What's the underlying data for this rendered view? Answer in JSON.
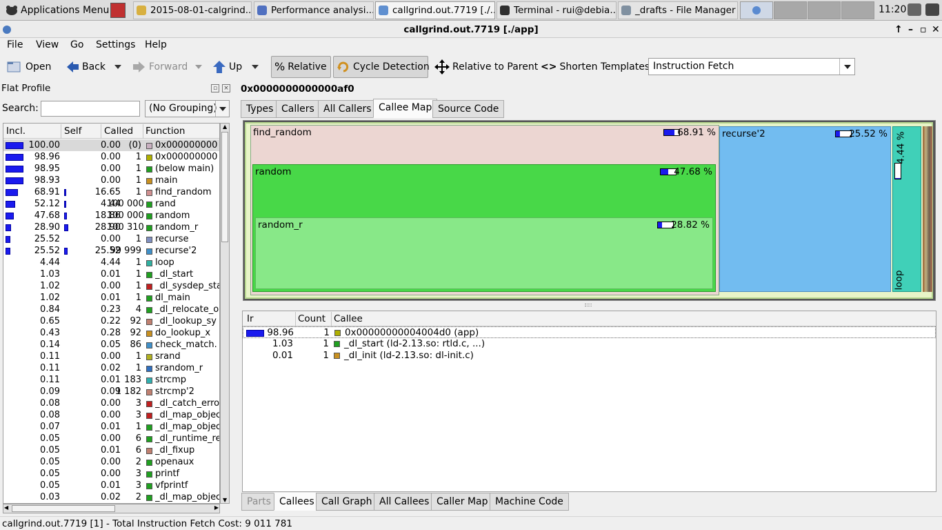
{
  "taskbar": {
    "apps_menu": "Applications Menu",
    "tasks": [
      {
        "label": "2015-08-01-calgrind...",
        "color": "#d8b040"
      },
      {
        "label": "Performance analysi...",
        "color": "#5070c0"
      },
      {
        "label": "callgrind.out.7719 [./...",
        "color": "#6090d0"
      },
      {
        "label": "Terminal - rui@debia...",
        "color": "#303030"
      },
      {
        "label": "_drafts - File Manager",
        "color": "#8090a0"
      }
    ],
    "clock": "11:20"
  },
  "window": {
    "title": "callgrind.out.7719 [./app]"
  },
  "menubar": [
    "File",
    "View",
    "Go",
    "Settings",
    "Help"
  ],
  "toolbar": {
    "open": "Open",
    "back": "Back",
    "forward": "Forward",
    "up": "Up",
    "relative": "Relative",
    "cycle_detection": "Cycle Detection",
    "relative_to_parent": "Relative to Parent",
    "shorten_templates": "Shorten Templates",
    "event_type": "Instruction Fetch"
  },
  "flat_profile": {
    "title": "Flat Profile",
    "search_label": "Search:",
    "search_value": "",
    "grouping": "(No Grouping)",
    "columns": [
      "Incl.",
      "Self",
      "Called",
      "Function"
    ],
    "rows": [
      {
        "incl": "100.00",
        "self": "0.00",
        "called": "(0)",
        "fn": "0x000000000",
        "color": "#c8b0c0",
        "ibar": 100,
        "sbar": 0
      },
      {
        "incl": "98.96",
        "self": "0.00",
        "called": "1",
        "fn": "0x000000000",
        "color": "#b0b000",
        "ibar": 99,
        "sbar": 0
      },
      {
        "incl": "98.95",
        "self": "0.00",
        "called": "1",
        "fn": "(below main)",
        "color": "#20a020",
        "ibar": 99,
        "sbar": 0
      },
      {
        "incl": "98.93",
        "self": "0.00",
        "called": "1",
        "fn": "main",
        "color": "#c89020",
        "ibar": 99,
        "sbar": 0
      },
      {
        "incl": "68.91",
        "self": "16.65",
        "called": "1",
        "fn": "find_random",
        "color": "#d09090",
        "ibar": 69,
        "sbar": 17
      },
      {
        "incl": "52.12",
        "self": "4.44",
        "called": "100 000",
        "fn": "rand",
        "color": "#20a020",
        "ibar": 52,
        "sbar": 4
      },
      {
        "incl": "47.68",
        "self": "18.86",
        "called": "100 000",
        "fn": "random",
        "color": "#20a020",
        "ibar": 48,
        "sbar": 19
      },
      {
        "incl": "28.90",
        "self": "28.90",
        "called": "100 310",
        "fn": "random_r",
        "color": "#20a020",
        "ibar": 29,
        "sbar": 29
      },
      {
        "incl": "25.52",
        "self": "0.00",
        "called": "1",
        "fn": "recurse",
        "color": "#8090c0",
        "ibar": 26,
        "sbar": 0
      },
      {
        "incl": "25.52",
        "self": "25.52",
        "called": "99 999",
        "fn": "recurse'2",
        "color": "#4090c8",
        "ibar": 26,
        "sbar": 26
      },
      {
        "incl": "4.44",
        "self": "4.44",
        "called": "1",
        "fn": "loop",
        "color": "#30b0a0",
        "ibar": 0,
        "sbar": 0
      },
      {
        "incl": "1.03",
        "self": "0.01",
        "called": "1",
        "fn": "_dl_start",
        "color": "#20a020",
        "ibar": 0,
        "sbar": 0
      },
      {
        "incl": "1.02",
        "self": "0.00",
        "called": "1",
        "fn": "_dl_sysdep_sta",
        "color": "#c02020",
        "ibar": 0,
        "sbar": 0
      },
      {
        "incl": "1.02",
        "self": "0.01",
        "called": "1",
        "fn": "dl_main",
        "color": "#20a020",
        "ibar": 0,
        "sbar": 0
      },
      {
        "incl": "0.84",
        "self": "0.23",
        "called": "4",
        "fn": "_dl_relocate_o",
        "color": "#20a020",
        "ibar": 0,
        "sbar": 0
      },
      {
        "incl": "0.65",
        "self": "0.22",
        "called": "92",
        "fn": "_dl_lookup_sy",
        "color": "#c08070",
        "ibar": 0,
        "sbar": 0
      },
      {
        "incl": "0.43",
        "self": "0.28",
        "called": "92",
        "fn": "do_lookup_x",
        "color": "#c89020",
        "ibar": 0,
        "sbar": 0
      },
      {
        "incl": "0.14",
        "self": "0.05",
        "called": "86",
        "fn": "check_match.",
        "color": "#4090c8",
        "ibar": 0,
        "sbar": 0
      },
      {
        "incl": "0.11",
        "self": "0.00",
        "called": "1",
        "fn": "srand",
        "color": "#b0b020",
        "ibar": 0,
        "sbar": 0
      },
      {
        "incl": "0.11",
        "self": "0.02",
        "called": "1",
        "fn": "srandom_r",
        "color": "#3070c0",
        "ibar": 0,
        "sbar": 0
      },
      {
        "incl": "0.11",
        "self": "0.01",
        "called": "183",
        "fn": "strcmp",
        "color": "#30b0b0",
        "ibar": 0,
        "sbar": 0
      },
      {
        "incl": "0.09",
        "self": "0.09",
        "called": "1 182",
        "fn": "strcmp'2",
        "color": "#c08070",
        "ibar": 0,
        "sbar": 0
      },
      {
        "incl": "0.08",
        "self": "0.00",
        "called": "3",
        "fn": "_dl_catch_erro",
        "color": "#c02020",
        "ibar": 0,
        "sbar": 0
      },
      {
        "incl": "0.08",
        "self": "0.00",
        "called": "3",
        "fn": "_dl_map_objec",
        "color": "#c02020",
        "ibar": 0,
        "sbar": 0
      },
      {
        "incl": "0.07",
        "self": "0.01",
        "called": "1",
        "fn": "_dl_map_objec",
        "color": "#20a020",
        "ibar": 0,
        "sbar": 0
      },
      {
        "incl": "0.05",
        "self": "0.00",
        "called": "6",
        "fn": "_dl_runtime_re",
        "color": "#20a020",
        "ibar": 0,
        "sbar": 0
      },
      {
        "incl": "0.05",
        "self": "0.01",
        "called": "6",
        "fn": "_dl_fixup",
        "color": "#c08070",
        "ibar": 0,
        "sbar": 0
      },
      {
        "incl": "0.05",
        "self": "0.00",
        "called": "2",
        "fn": "openaux",
        "color": "#20a020",
        "ibar": 0,
        "sbar": 0
      },
      {
        "incl": "0.05",
        "self": "0.00",
        "called": "3",
        "fn": "printf",
        "color": "#20a020",
        "ibar": 0,
        "sbar": 0
      },
      {
        "incl": "0.05",
        "self": "0.01",
        "called": "3",
        "fn": "vfprintf",
        "color": "#20a020",
        "ibar": 0,
        "sbar": 0
      },
      {
        "incl": "0.03",
        "self": "0.02",
        "called": "2",
        "fn": "_dl_map_objec",
        "color": "#20a020",
        "ibar": 0,
        "sbar": 0
      }
    ]
  },
  "detail": {
    "function_title": "0x0000000000000af0",
    "top_tabs": [
      "Types",
      "Callers",
      "All Callers",
      "Callee Map",
      "Source Code"
    ],
    "treemap": {
      "find_random": {
        "label": "find_random",
        "pct": "68.91 %",
        "fill": 0.69
      },
      "random": {
        "label": "random",
        "pct": "47.68 %",
        "fill": 0.48
      },
      "random_r": {
        "label": "random_r",
        "pct": "28.82 %",
        "fill": 0.29
      },
      "recurse2": {
        "label": "recurse'2",
        "pct": "25.52 %",
        "fill": 0.26
      },
      "loop": {
        "label": "loop",
        "pct": "4.44 %",
        "fill": 0.04
      }
    },
    "callees_columns": [
      "Ir",
      "Count",
      "Callee"
    ],
    "callees": [
      {
        "ir": "98.96",
        "count": "1",
        "callee": "0x00000000004004d0 (app)",
        "color": "#b0b000",
        "bar": 99
      },
      {
        "ir": "1.03",
        "count": "1",
        "callee": "_dl_start (ld-2.13.so: rtld.c, ...)",
        "color": "#20a020",
        "bar": 0
      },
      {
        "ir": "0.01",
        "count": "1",
        "callee": "_dl_init (ld-2.13.so: dl-init.c)",
        "color": "#c89020",
        "bar": 0
      }
    ],
    "bottom_tabs": [
      "Parts",
      "Callees",
      "Call Graph",
      "All Callees",
      "Caller Map",
      "Machine Code"
    ]
  },
  "status": "callgrind.out.7719 [1] - Total Instruction Fetch Cost: 9 011 781"
}
